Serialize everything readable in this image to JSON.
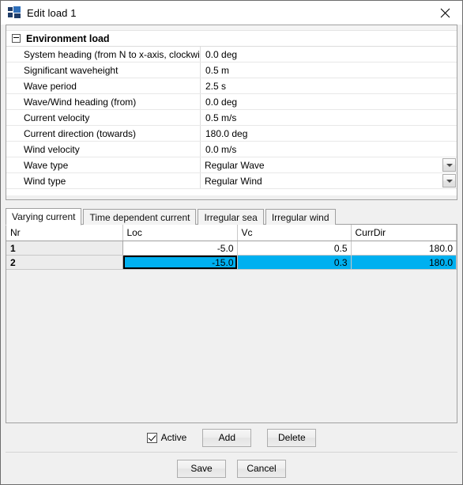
{
  "window": {
    "title": "Edit load 1",
    "icon": "app-icon",
    "close_icon": "close-icon"
  },
  "property_grid": {
    "category": "Environment load",
    "expander_state": "expanded",
    "rows": [
      {
        "label": "System heading (from N to x-axis, clockwise)",
        "value": "0.0 deg",
        "type": "text"
      },
      {
        "label": "Significant waveheight",
        "value": "0.5 m",
        "type": "text"
      },
      {
        "label": "Wave period",
        "value": "2.5 s",
        "type": "text"
      },
      {
        "label": "Wave/Wind heading (from)",
        "value": "0.0 deg",
        "type": "text"
      },
      {
        "label": "Current velocity",
        "value": "0.5 m/s",
        "type": "text"
      },
      {
        "label": "Current direction (towards)",
        "value": "180.0 deg",
        "type": "text"
      },
      {
        "label": "Wind velocity",
        "value": "0.0 m/s",
        "type": "text"
      },
      {
        "label": "Wave type",
        "value": "Regular Wave",
        "type": "combo"
      },
      {
        "label": "Wind type",
        "value": "Regular Wind",
        "type": "combo"
      }
    ]
  },
  "tabs": {
    "active_index": 0,
    "items": [
      {
        "label": "Varying current"
      },
      {
        "label": "Time dependent current"
      },
      {
        "label": "Irregular sea"
      },
      {
        "label": "Irregular wind"
      }
    ]
  },
  "table": {
    "columns": [
      "Nr",
      "Loc",
      "Vc",
      "CurrDir"
    ],
    "rows": [
      {
        "nr": "1",
        "loc": "-5.0",
        "vc": "0.5",
        "currdir": "180.0",
        "selected": false
      },
      {
        "nr": "2",
        "loc": "-15.0",
        "vc": "0.3",
        "currdir": "180.0",
        "selected": true
      }
    ],
    "active_cell": {
      "row": 2,
      "column": "Loc"
    },
    "selection_color": "#00b0f0"
  },
  "actions": {
    "active_label": "Active",
    "active_checked": true,
    "add_label": "Add",
    "delete_label": "Delete"
  },
  "footer": {
    "save_label": "Save",
    "cancel_label": "Cancel"
  }
}
